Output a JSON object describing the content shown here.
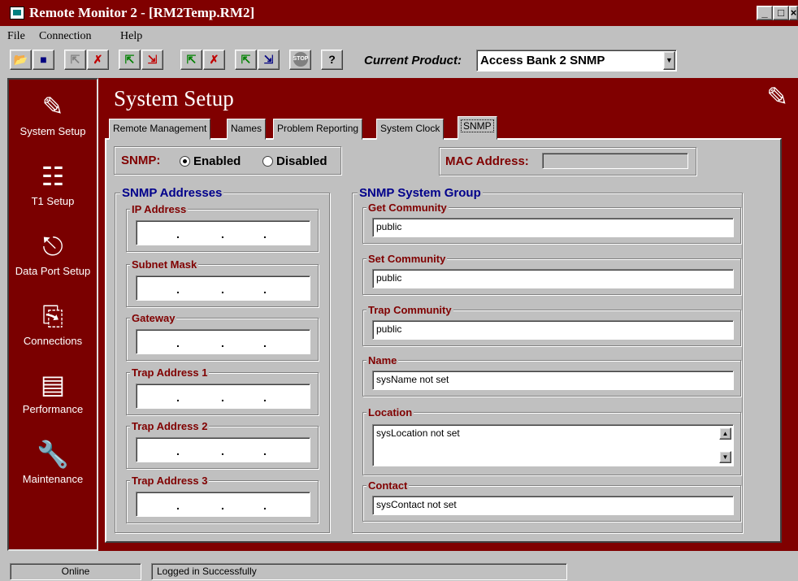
{
  "window": {
    "title": "Remote Monitor 2 - [RM2Temp.RM2]",
    "controls": [
      "_",
      "□",
      "×"
    ]
  },
  "menu": [
    "File",
    "Connection",
    "Help"
  ],
  "toolbar": {
    "current_product_label": "Current Product:",
    "current_product_value": "Access Bank 2 SNMP",
    "help_label": "?",
    "stop_label": "STOP"
  },
  "sidebar": {
    "items": [
      "System Setup",
      "T1 Setup",
      "Data Port Setup",
      "Connections",
      "Performance",
      "Maintenance"
    ]
  },
  "page": {
    "title": "System Setup"
  },
  "tabs": [
    "Remote Management",
    "Names",
    "Problem Reporting",
    "System Clock",
    "SNMP"
  ],
  "snmp": {
    "label": "SNMP:",
    "enabled_label": "Enabled",
    "disabled_label": "Disabled",
    "selected": "Enabled"
  },
  "mac": {
    "label": "MAC Address:",
    "value": ""
  },
  "addresses": {
    "title": "SNMP Addresses",
    "fields": [
      {
        "label": "IP Address",
        "value": ". . ."
      },
      {
        "label": "Subnet Mask",
        "value": ". . ."
      },
      {
        "label": "Gateway",
        "value": ". . ."
      },
      {
        "label": "Trap Address 1",
        "value": ". . ."
      },
      {
        "label": "Trap Address 2",
        "value": ". . ."
      },
      {
        "label": "Trap Address 3",
        "value": ". . ."
      }
    ]
  },
  "system_group": {
    "title": "SNMP System Group",
    "fields": [
      {
        "label": "Get Community",
        "value": "public"
      },
      {
        "label": "Set Community",
        "value": "public"
      },
      {
        "label": "Trap Community",
        "value": "public"
      },
      {
        "label": "Name",
        "value": "sysName not set"
      },
      {
        "label": "Location",
        "value": "sysLocation not set"
      },
      {
        "label": "Contact",
        "value": "sysContact not set"
      }
    ]
  },
  "status": {
    "left": "Online",
    "right": "Logged in Successfully"
  },
  "colors": {
    "maroon": "#800000",
    "sidebar": "#7a0000",
    "group_title": "#00008b",
    "face": "#c0c0c0"
  }
}
